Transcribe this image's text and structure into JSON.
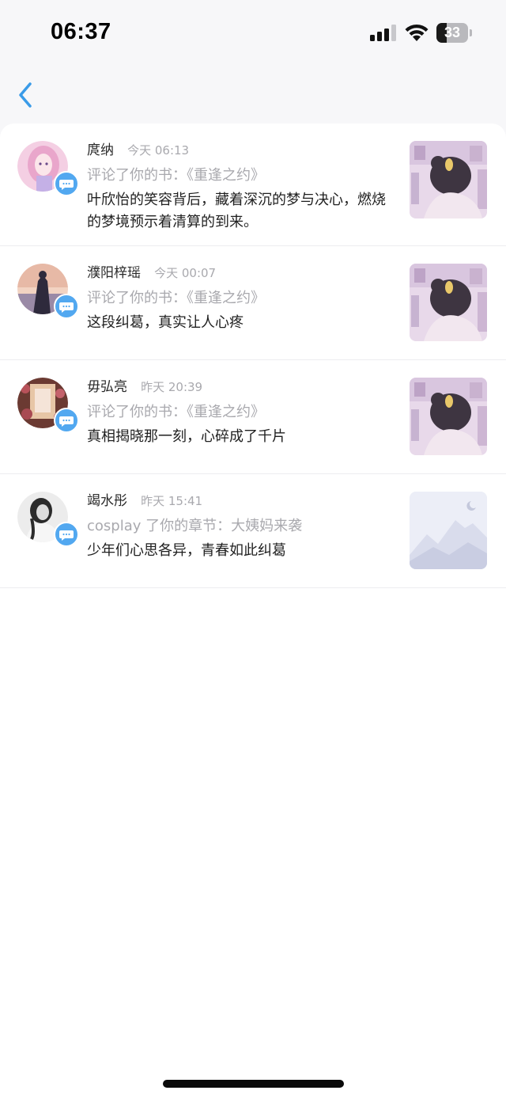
{
  "status_bar": {
    "time": "06:37",
    "battery_level": "33",
    "battery_fraction": 0.33
  },
  "nav": {
    "back_icon": "chevron-left-icon",
    "accent_color": "#3a9be8"
  },
  "notifications": [
    {
      "user": "庹纳",
      "time": "今天 06:13",
      "action": "评论了你的书：《重逢之约》",
      "comment": "叶欣怡的笑容背后，藏着深沉的梦与决心，燃烧的梦境预示着清算的到来。",
      "avatar_icon": "user-avatar",
      "thumb_icon": "book-cover"
    },
    {
      "user": "濮阳梓瑶",
      "time": "今天 00:07",
      "action": "评论了你的书：《重逢之约》",
      "comment": "这段纠葛，真实让人心疼",
      "avatar_icon": "user-avatar",
      "thumb_icon": "book-cover"
    },
    {
      "user": "毋弘亮",
      "time": "昨天 20:39",
      "action": "评论了你的书：《重逢之约》",
      "comment": "真相揭晓那一刻，心碎成了千片",
      "avatar_icon": "user-avatar",
      "thumb_icon": "book-cover"
    },
    {
      "user": "竭水彤",
      "time": "昨天 15:41",
      "action": "cosplay 了你的章节：大姨妈来袭",
      "comment": "少年们心思各异，青春如此纠葛",
      "avatar_icon": "user-avatar",
      "thumb_icon": "image-placeholder"
    }
  ],
  "colors": {
    "badge": "#52a8f0",
    "secondary_text": "#a9a9ae",
    "primary_text": "#1f1f1f"
  }
}
